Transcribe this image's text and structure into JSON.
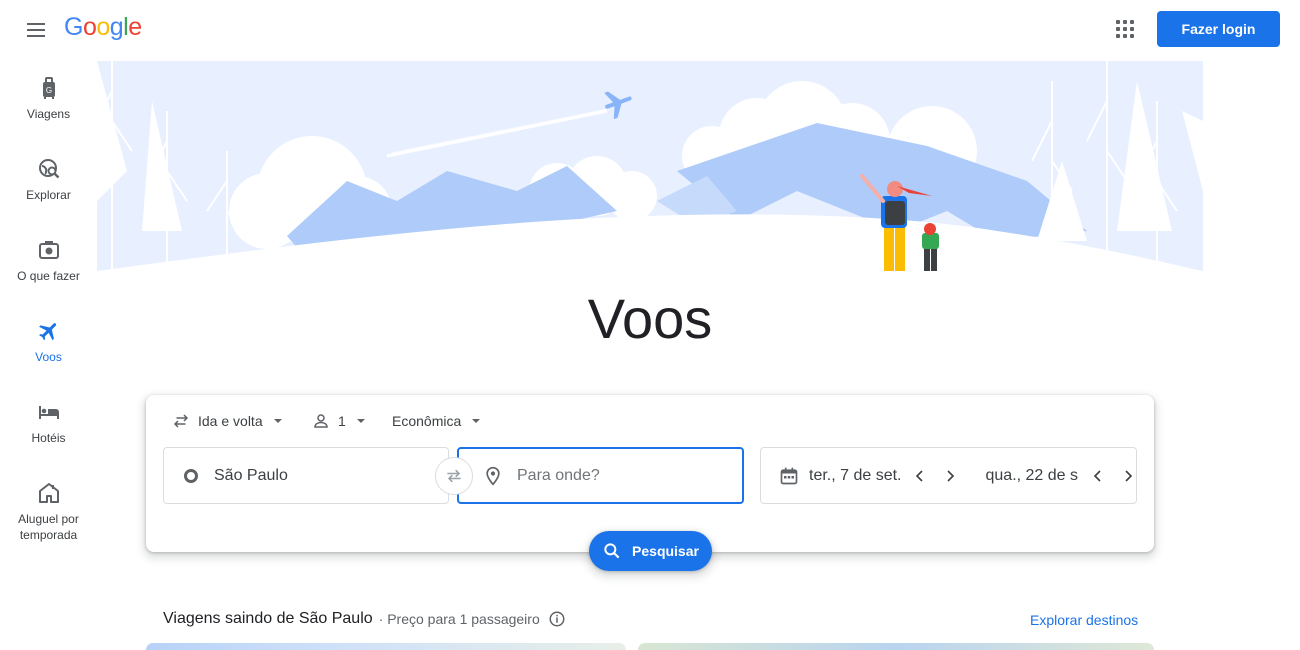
{
  "header": {
    "menu_icon": "hamburger-menu-icon",
    "logo": {
      "letters": [
        "G",
        "o",
        "o",
        "g",
        "l",
        "e"
      ],
      "colors": [
        "#4285f4",
        "#ea4335",
        "#fbbc05",
        "#4285f4",
        "#34a853",
        "#ea4335"
      ]
    },
    "apps_icon": "apps-grid-icon",
    "login_label": "Fazer login"
  },
  "sidebar": {
    "items": [
      {
        "label": "Viagens",
        "icon": "luggage-icon",
        "active": false
      },
      {
        "label": "Explorar",
        "icon": "globe-search-icon",
        "active": false
      },
      {
        "label": "O que fazer",
        "icon": "camera-icon",
        "active": false
      },
      {
        "label": "Voos",
        "icon": "airplane-icon",
        "active": true
      },
      {
        "label": "Hotéis",
        "icon": "bed-icon",
        "active": false
      },
      {
        "label": "Aluguel por temporada",
        "label_lines": [
          "Aluguel por",
          "temporada"
        ],
        "icon": "house-icon",
        "active": false
      }
    ]
  },
  "page_title": "Voos",
  "search": {
    "trip_type": "Ida e volta",
    "passengers": "1",
    "cabin_class": "Econômica",
    "origin": "São Paulo",
    "destination_placeholder": "Para onde?",
    "departure_date": "ter., 7 de set.",
    "return_date": "qua., 22 de s",
    "search_label": "Pesquisar"
  },
  "trips": {
    "title": "Viagens saindo de São Paulo",
    "subtitle": "· Preço para 1 passageiro",
    "explore_label": "Explorar destinos"
  },
  "colors": {
    "accent": "#1a73e8",
    "text": "#202124",
    "muted": "#5f6368",
    "hero_sky": "#e8efff",
    "hero_mountain": "#aecbfa"
  }
}
